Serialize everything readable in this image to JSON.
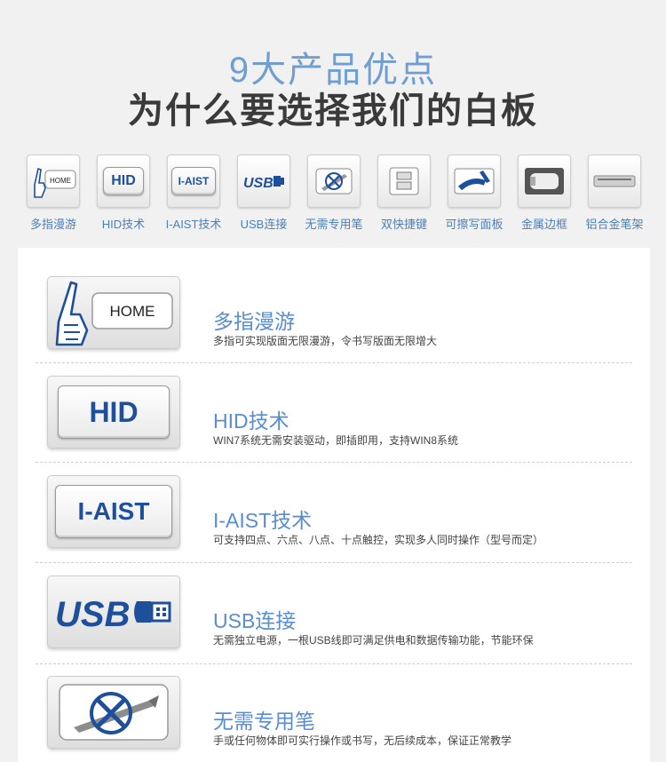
{
  "hero": {
    "subtitle": "9大产品优点",
    "title": "为什么要选择我们的白板"
  },
  "features": [
    {
      "label": "多指漫游",
      "icon": "hand-pointer-icon",
      "key_text": "HOME"
    },
    {
      "label": "HID技术",
      "icon": "hid-key-icon",
      "key_text": "HID"
    },
    {
      "label": "I-AIST技术",
      "icon": "iaist-key-icon",
      "key_text": "I-AIST"
    },
    {
      "label": "USB连接",
      "icon": "usb-icon",
      "key_text": "USB"
    },
    {
      "label": "无需专用笔",
      "icon": "no-pen-icon",
      "key_text": ""
    },
    {
      "label": "双快捷键",
      "icon": "shortcut-keys-icon",
      "key_text": ""
    },
    {
      "label": "可擦写面板",
      "icon": "erasable-board-icon",
      "key_text": ""
    },
    {
      "label": "金属边框",
      "icon": "metal-frame-icon",
      "key_text": ""
    },
    {
      "label": "铝合金笔架",
      "icon": "pen-tray-icon",
      "key_text": ""
    }
  ],
  "details": [
    {
      "title": "多指漫游",
      "desc": "多指可实现版面无限漫游，令书写版面无限增大",
      "icon": "hand-pointer-icon",
      "key_text": "HOME"
    },
    {
      "title": "HID技术",
      "desc": "WIN7系统无需安装驱动，即插即用，支持WIN8系统",
      "icon": "hid-key-icon",
      "key_text": "HID"
    },
    {
      "title": "I-AIST技术",
      "desc": "可支持四点、六点、八点、十点触控，实现多人同时操作（型号而定）",
      "icon": "iaist-key-icon",
      "key_text": "I-AIST"
    },
    {
      "title": "USB连接",
      "desc": "无需独立电源，一根USB线即可满足供电和数据传输功能，节能环保",
      "icon": "usb-icon",
      "key_text": "USB"
    },
    {
      "title": "无需专用笔",
      "desc": "手或任何物体即可实行操作或书写，无后续成本，保证正常教学",
      "icon": "no-pen-icon",
      "key_text": ""
    }
  ],
  "colors": {
    "accent": "#5a8cd0",
    "heading": "#3a3a3a",
    "key_blue": "#1d4f9b"
  }
}
